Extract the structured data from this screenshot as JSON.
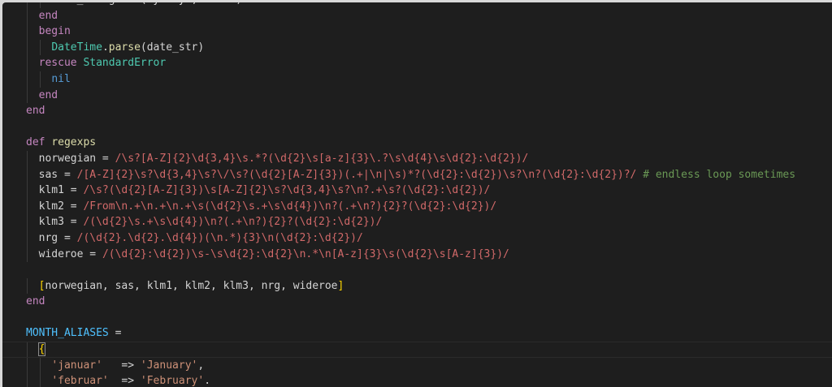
{
  "editor": {
    "language": "ruby",
    "lines": [
      {
        "indent": 2,
        "tokens": [
          [
            "plain",
            "date_str.gsub!(synonym, month)"
          ]
        ]
      },
      {
        "indent": 1,
        "tokens": [
          [
            "kw",
            "end"
          ]
        ]
      },
      {
        "indent": 1,
        "tokens": [
          [
            "kw",
            "begin"
          ]
        ]
      },
      {
        "indent": 2,
        "tokens": [
          [
            "type",
            "DateTime"
          ],
          [
            "plain",
            "."
          ],
          [
            "fn",
            "parse"
          ],
          [
            "plain",
            "(date_str)"
          ]
        ]
      },
      {
        "indent": 1,
        "tokens": [
          [
            "kw",
            "rescue"
          ],
          [
            "plain",
            " "
          ],
          [
            "type",
            "StandardError"
          ]
        ]
      },
      {
        "indent": 2,
        "tokens": [
          [
            "nil",
            "nil"
          ]
        ]
      },
      {
        "indent": 1,
        "tokens": [
          [
            "kw",
            "end"
          ]
        ]
      },
      {
        "indent": 0,
        "tokens": [
          [
            "kw",
            "end"
          ]
        ]
      },
      {
        "indent": 0,
        "tokens": []
      },
      {
        "indent": 0,
        "tokens": [
          [
            "kw",
            "def"
          ],
          [
            "plain",
            " "
          ],
          [
            "fn",
            "regexps"
          ]
        ]
      },
      {
        "indent": 1,
        "tokens": [
          [
            "plain",
            "norwegian = "
          ],
          [
            "re",
            "/\\s?[A-Z]{2}\\d{3,4}\\s.*?(\\d{2}\\s[a-z]{3}\\.?\\s\\d{4}\\s\\d{2}:\\d{2})/"
          ]
        ]
      },
      {
        "indent": 1,
        "tokens": [
          [
            "plain",
            "sas = "
          ],
          [
            "re",
            "/[A-Z]{2}\\s?\\d{3,4}\\s?\\/\\s?(\\d{2}[A-Z]{3})(.+|\\n|\\s)*?(\\d{2}:\\d{2})\\s?\\n?(\\d{2}:\\d{2})?/"
          ],
          [
            "plain",
            " "
          ],
          [
            "cm",
            "# endless loop sometimes"
          ]
        ]
      },
      {
        "indent": 1,
        "tokens": [
          [
            "plain",
            "klm1 = "
          ],
          [
            "re",
            "/\\s?(\\d{2}[A-Z]{3})\\s[A-Z]{2}\\s?\\d{3,4}\\s?\\n?.+\\s?(\\d{2}:\\d{2})/"
          ]
        ]
      },
      {
        "indent": 1,
        "tokens": [
          [
            "plain",
            "klm2 = "
          ],
          [
            "re",
            "/From\\n.+\\n.+\\n.+\\s(\\d{2}\\s.+\\s\\d{4})\\n?(.+\\n?){2}?(\\d{2}:\\d{2})/"
          ]
        ]
      },
      {
        "indent": 1,
        "tokens": [
          [
            "plain",
            "klm3 = "
          ],
          [
            "re",
            "/(\\d{2}\\s.+\\s\\d{4})\\n?(.+\\n?){2}?(\\d{2}:\\d{2})/"
          ]
        ]
      },
      {
        "indent": 1,
        "tokens": [
          [
            "plain",
            "nrg = "
          ],
          [
            "re",
            "/(\\d{2}.\\d{2}.\\d{4})(\\n.*){3}\\n(\\d{2}:\\d{2})/"
          ]
        ]
      },
      {
        "indent": 1,
        "tokens": [
          [
            "plain",
            "wideroe = "
          ],
          [
            "re",
            "/(\\d{2}:\\d{2})\\s-\\s\\d{2}:\\d{2}\\n.*\\n[A-z]{3}\\s(\\d{2}\\s[A-z]{3})/"
          ]
        ]
      },
      {
        "indent": 0,
        "tokens": []
      },
      {
        "indent": 1,
        "tokens": [
          [
            "brk",
            "["
          ],
          [
            "plain",
            "norwegian, sas, klm1, klm2, klm3, nrg, wideroe"
          ],
          [
            "brk",
            "]"
          ]
        ]
      },
      {
        "indent": 0,
        "tokens": [
          [
            "kw",
            "end"
          ]
        ]
      },
      {
        "indent": 0,
        "tokens": []
      },
      {
        "indent": 0,
        "tokens": [
          [
            "const",
            "MONTH_ALIASES"
          ],
          [
            "plain",
            " ="
          ]
        ]
      },
      {
        "indent": 1,
        "cursor": true,
        "tokens": [
          [
            "brkbox",
            "{"
          ]
        ]
      },
      {
        "indent": 2,
        "tokens": [
          [
            "str",
            "'januar'"
          ],
          [
            "plain",
            "   => "
          ],
          [
            "str",
            "'January'"
          ],
          [
            "plain",
            ","
          ]
        ]
      },
      {
        "indent": 2,
        "tokens": [
          [
            "str",
            "'februar'"
          ],
          [
            "plain",
            "  => "
          ],
          [
            "str",
            "'February'"
          ],
          [
            "plain",
            "."
          ]
        ]
      }
    ]
  }
}
